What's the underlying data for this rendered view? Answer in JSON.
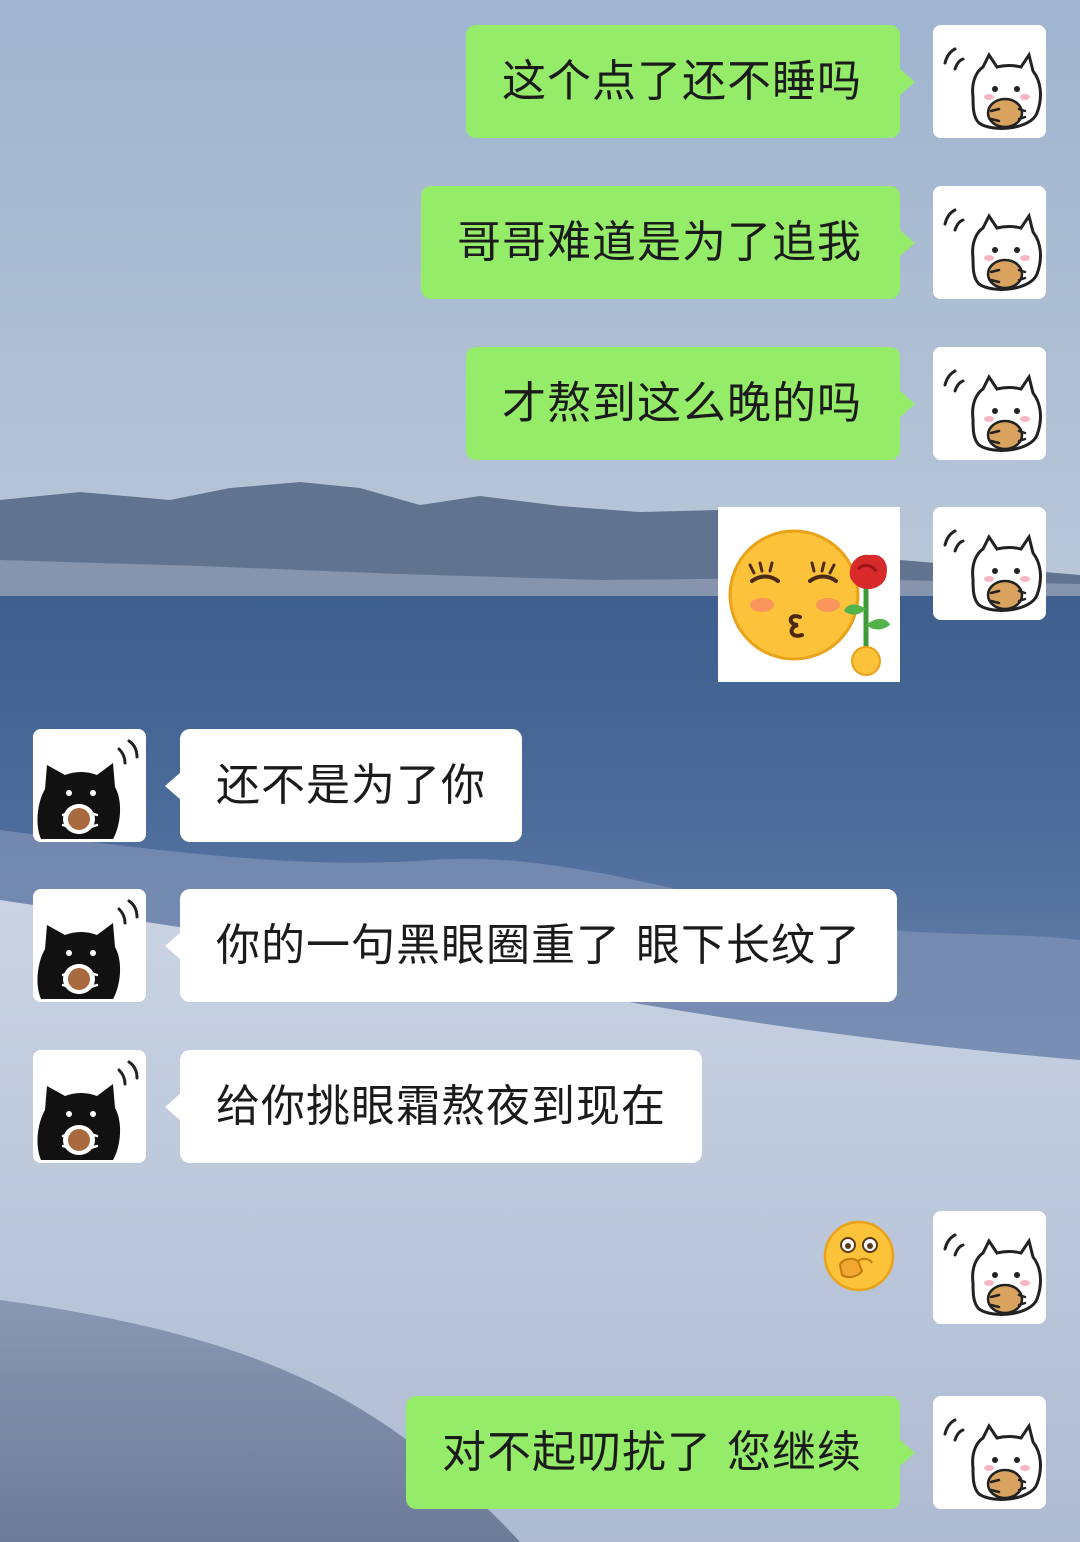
{
  "chat": {
    "messages": [
      {
        "side": "out",
        "type": "text",
        "text": "这个点了还不睡吗"
      },
      {
        "side": "out",
        "type": "text",
        "text": "哥哥难道是为了追我"
      },
      {
        "side": "out",
        "type": "text",
        "text": "才熬到这么晚的吗"
      },
      {
        "side": "out",
        "type": "sticker",
        "icon": "kiss-rose-emoji-icon"
      },
      {
        "side": "in",
        "type": "text",
        "text": "还不是为了你"
      },
      {
        "side": "in",
        "type": "text",
        "text": "你的一句黑眼圈重了 眼下长纹了"
      },
      {
        "side": "in",
        "type": "text",
        "text": "给你挑眼霜熬夜到现在"
      },
      {
        "side": "out",
        "type": "emoji",
        "icon": "shy-cover-mouth-emoji-icon"
      },
      {
        "side": "out",
        "type": "text",
        "text": "对不起叨扰了 您继续"
      }
    ],
    "avatars": {
      "self": "white-cat-avatar-icon",
      "other": "black-cat-avatar-icon"
    },
    "colors": {
      "outgoing_bubble": "#95ec69",
      "incoming_bubble": "#ffffff",
      "text": "#1b1b1b"
    }
  }
}
